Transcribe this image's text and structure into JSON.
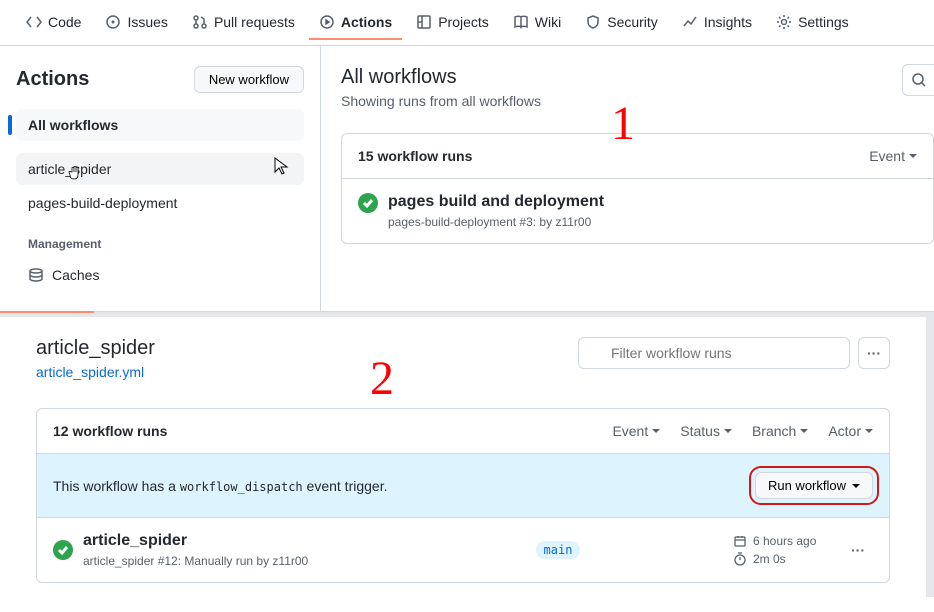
{
  "nav": {
    "code": "Code",
    "issues": "Issues",
    "pulls": "Pull requests",
    "actions": "Actions",
    "projects": "Projects",
    "wiki": "Wiki",
    "security": "Security",
    "insights": "Insights",
    "settings": "Settings"
  },
  "sidebar": {
    "title": "Actions",
    "newWorkflow": "New workflow",
    "all": "All workflows",
    "items": [
      "article_spider",
      "pages-build-deployment"
    ],
    "section": "Management",
    "caches": "Caches"
  },
  "content1": {
    "title": "All workflows",
    "subtitle": "Showing runs from all workflows",
    "count": "15 workflow runs",
    "eventFilter": "Event",
    "run": {
      "title": "pages build and deployment",
      "sub": "pages-build-deployment #3: by z11r00"
    },
    "annotation": "1"
  },
  "content2": {
    "title": "article_spider",
    "yml": "article_spider.yml",
    "filterPlaceholder": "Filter workflow runs",
    "count": "12 workflow runs",
    "filters": [
      "Event",
      "Status",
      "Branch",
      "Actor"
    ],
    "dispatch": {
      "pre": "This workflow has a ",
      "code": "workflow_dispatch",
      "post": " event trigger."
    },
    "runBtn": "Run workflow",
    "run": {
      "title": "article_spider",
      "sub": "article_spider #12: Manually run by z11r00",
      "branch": "main",
      "time": "6 hours ago",
      "duration": "2m 0s"
    },
    "annotation": "2"
  }
}
